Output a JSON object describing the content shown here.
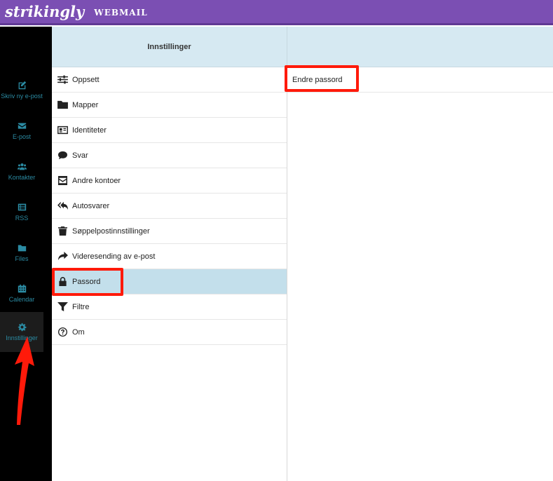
{
  "topbar": {
    "logo": "strikingly",
    "product": "WEBMAIL"
  },
  "nav": {
    "items": [
      {
        "label": "Skriv ny e-post",
        "icon": "compose-icon"
      },
      {
        "label": "E-post",
        "icon": "envelope-icon"
      },
      {
        "label": "Kontakter",
        "icon": "users-icon"
      },
      {
        "label": "RSS",
        "icon": "list-icon"
      },
      {
        "label": "Files",
        "icon": "folder-icon"
      },
      {
        "label": "Calendar",
        "icon": "calendar-icon"
      },
      {
        "label": "Innstillinger",
        "icon": "gear-icon"
      }
    ],
    "active": "Innstillinger"
  },
  "settings": {
    "header": "Innstillinger",
    "items": [
      {
        "label": "Oppsett",
        "icon": "sliders-icon"
      },
      {
        "label": "Mapper",
        "icon": "folder-icon"
      },
      {
        "label": "Identiteter",
        "icon": "id-card-icon"
      },
      {
        "label": "Svar",
        "icon": "speech-bubble-icon"
      },
      {
        "label": "Andre kontoer",
        "icon": "envelope-square-icon"
      },
      {
        "label": "Autosvarer",
        "icon": "reply-all-icon"
      },
      {
        "label": "Søppelpostinnstillinger",
        "icon": "trash-icon"
      },
      {
        "label": "Videresending av e-post",
        "icon": "forward-icon"
      },
      {
        "label": "Passord",
        "icon": "lock-icon"
      },
      {
        "label": "Filtre",
        "icon": "filter-icon"
      },
      {
        "label": "Om",
        "icon": "question-circle-icon"
      }
    ],
    "selected": "Passord"
  },
  "content": {
    "items": [
      {
        "label": "Endre passord"
      }
    ]
  },
  "annotations": {
    "highlight_color": "#ff1a0a"
  }
}
